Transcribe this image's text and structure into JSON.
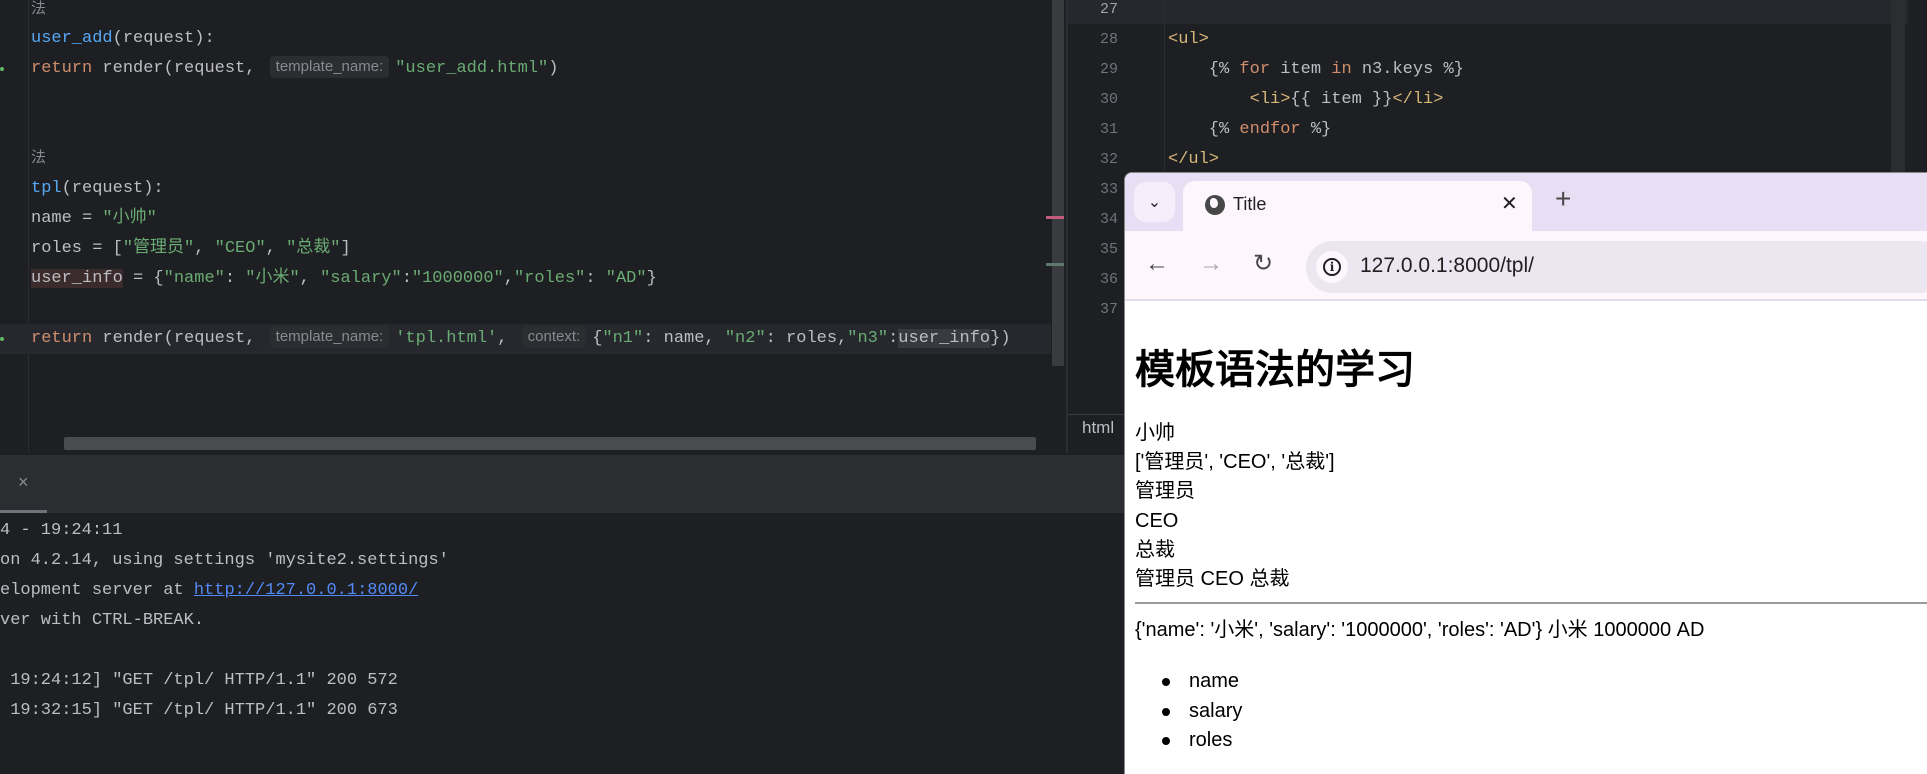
{
  "left_editor": {
    "lines": [
      [
        [
          "法",
          "cm"
        ]
      ],
      [
        [
          "user_add",
          "fn"
        ],
        [
          "(request):",
          "id"
        ]
      ],
      [
        [
          "return ",
          "kw"
        ],
        [
          "render(request, ",
          "id"
        ],
        [
          "template_name:",
          "hint"
        ],
        [
          "\"user_add.html\"",
          "str"
        ],
        [
          ")",
          "id"
        ]
      ],
      [
        [
          "法",
          "cm"
        ]
      ],
      [
        [
          "tpl",
          "fn"
        ],
        [
          "(request):",
          "id"
        ]
      ],
      [
        [
          "name = ",
          "id"
        ],
        [
          "\"小帅\"",
          "str"
        ]
      ],
      [
        [
          "roles = [",
          "id"
        ],
        [
          "\"管理员\"",
          "str"
        ],
        [
          ", ",
          "id"
        ],
        [
          "\"CEO\"",
          "str"
        ],
        [
          ", ",
          "id"
        ],
        [
          "\"总裁\"",
          "str"
        ],
        [
          "]",
          "id"
        ]
      ],
      [
        [
          "user_info",
          "hl-red"
        ],
        [
          " = {",
          "id"
        ],
        [
          "\"name\"",
          "str"
        ],
        [
          ": ",
          "id"
        ],
        [
          "\"小米\"",
          "str"
        ],
        [
          ", ",
          "id"
        ],
        [
          "\"salary\"",
          "str"
        ],
        [
          ":",
          "id"
        ],
        [
          "\"1000000\"",
          "str"
        ],
        [
          ",",
          "id"
        ],
        [
          "\"roles\"",
          "str"
        ],
        [
          ": ",
          "id"
        ],
        [
          "\"AD\"",
          "str"
        ],
        [
          "}",
          "id"
        ]
      ],
      [
        [
          "return ",
          "kw"
        ],
        [
          "render(request, ",
          "id"
        ],
        [
          "template_name:",
          "hint"
        ],
        [
          "'tpl.html'",
          "str"
        ],
        [
          ", ",
          "id"
        ],
        [
          "context:",
          "hint"
        ],
        [
          "{",
          "id"
        ],
        [
          "\"n1\"",
          "str"
        ],
        [
          ": name, ",
          "id"
        ],
        [
          "\"n2\"",
          "str"
        ],
        [
          ": roles,",
          "id"
        ],
        [
          "\"n3\"",
          "str"
        ],
        [
          ":",
          "id"
        ],
        [
          "user_info",
          "hl-grey"
        ],
        [
          "})",
          "id"
        ]
      ]
    ]
  },
  "right_editor": {
    "line_numbers": [
      "27",
      "28",
      "29",
      "30",
      "31",
      "32",
      "33",
      "34",
      "35",
      "36",
      "37"
    ],
    "lines": [
      [],
      [
        [
          "<ul>",
          "tag"
        ]
      ],
      [
        [
          "    {% ",
          "tpl"
        ],
        [
          "for ",
          "tkw"
        ],
        [
          "item ",
          "tpl"
        ],
        [
          "in ",
          "tkw"
        ],
        [
          "n3.keys %}",
          "tpl"
        ]
      ],
      [
        [
          "        <li>",
          "tag"
        ],
        [
          "{{ item }}",
          "tpl"
        ],
        [
          "</li>",
          "tag"
        ]
      ],
      [
        [
          "    {% ",
          "tpl"
        ],
        [
          "endfor ",
          "tkw"
        ],
        [
          "%}",
          "tpl"
        ]
      ],
      [
        [
          "</ul>",
          "tag"
        ]
      ]
    ],
    "tab_label": "html"
  },
  "terminal": {
    "close_icon": "×",
    "lines": [
      {
        "text": "4 - 19:24:11"
      },
      {
        "text": "on 4.2.14, using settings 'mysite2.settings'"
      },
      {
        "text": "elopment server at ",
        "link": "http://127.0.0.1:8000/"
      },
      {
        "text": "ver with CTRL-BREAK."
      },
      {
        "text": " 19:24:12] \"GET /tpl/ HTTP/1.1\" 200 572"
      },
      {
        "text": " 19:32:15] \"GET /tpl/ HTTP/1.1\" 200 673"
      }
    ]
  },
  "browser": {
    "tab_title": "Title",
    "tab_close": "✕",
    "new_tab": "+",
    "tab_menu": "⌄",
    "back": "←",
    "forward": "→",
    "reload": "↻",
    "url": "127.0.0.1:8000/tpl/",
    "page": {
      "heading": "模板语法的学习",
      "lines": [
        "小帅",
        "['管理员', 'CEO', '总裁']",
        "管理员",
        "CEO",
        "总裁",
        "管理员 CEO 总裁"
      ],
      "dict_line": "{'name': '小米', 'salary': '1000000', 'roles': 'AD'} 小米 1000000 AD",
      "list_items": [
        "name",
        "salary",
        "roles"
      ]
    }
  },
  "colors": {
    "keyword": "#cf8e6d",
    "function": "#56a8f5",
    "string": "#6aab73",
    "tag": "#d5b778",
    "link": "#548af7",
    "tabstrip": "#e9dff4"
  }
}
